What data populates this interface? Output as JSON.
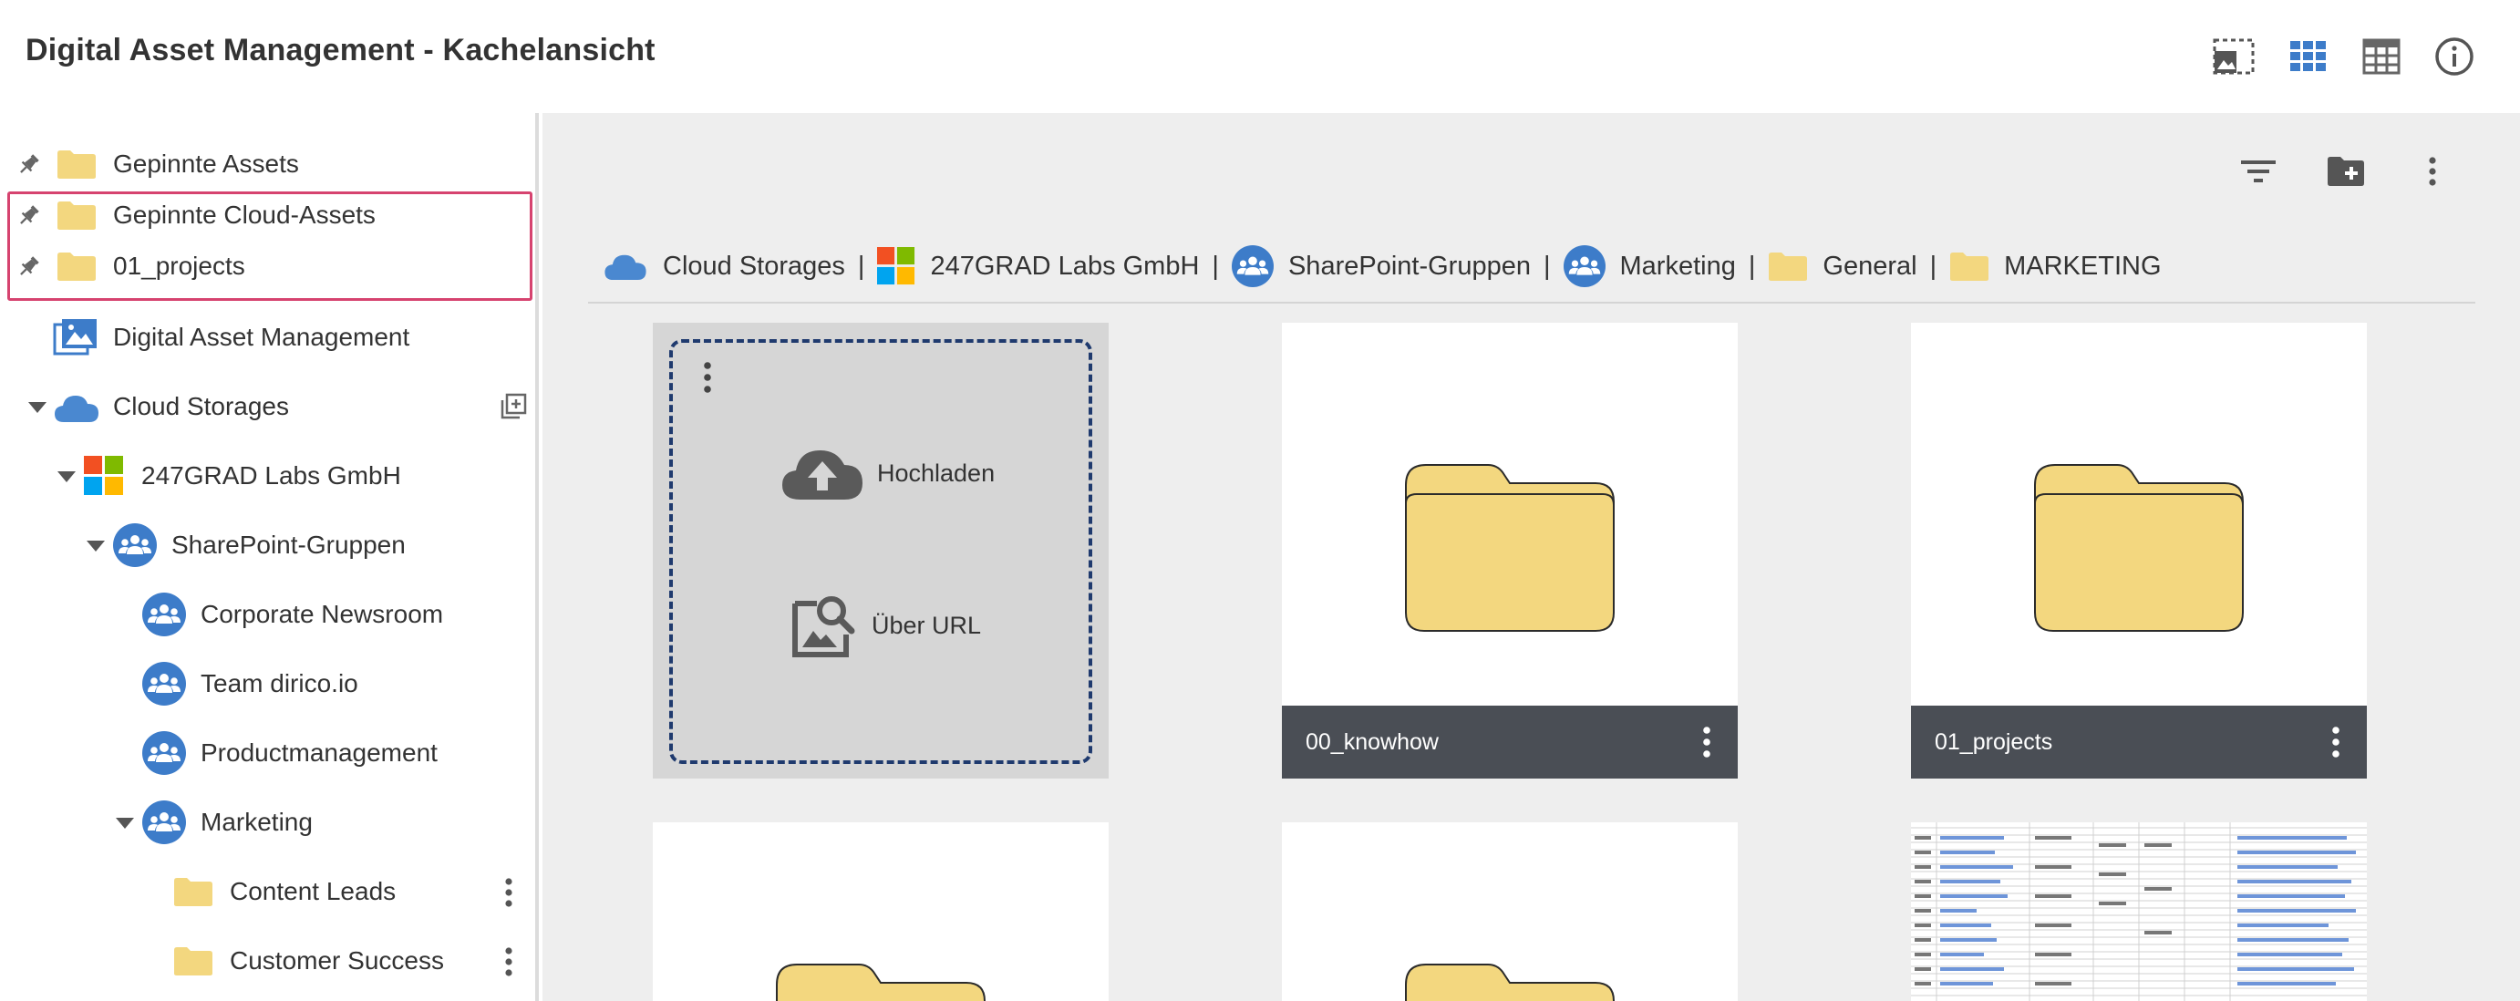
{
  "header": {
    "title": "Digital Asset Management - Kachelansicht",
    "icons": [
      "image-select-icon",
      "tile-view-icon",
      "table-view-icon",
      "info-icon"
    ],
    "accent": "#3d7cc9"
  },
  "sidebar": {
    "pinned": [
      {
        "label": "Gepinnte Assets"
      },
      {
        "label": "Gepinnte Cloud-Assets"
      },
      {
        "label": "01_projects"
      }
    ],
    "tree": {
      "dam_label": "Digital Asset Management",
      "cloud_label": "Cloud Storages",
      "company_label": "247GRAD Labs GmbH",
      "groups_label": "SharePoint-Gruppen",
      "groups": [
        {
          "label": "Corporate Newsroom"
        },
        {
          "label": "Team dirico.io"
        },
        {
          "label": "Productmanagement"
        },
        {
          "label": "Marketing"
        }
      ],
      "marketing_children": [
        {
          "label": "Content Leads"
        },
        {
          "label": "Customer Success"
        }
      ]
    },
    "highlight_color": "#d6436f"
  },
  "toolbar": {
    "icons": [
      "filter-icon",
      "new-folder-icon",
      "more-vert-icon"
    ]
  },
  "breadcrumb": {
    "items": [
      {
        "label": "Cloud Storages",
        "icon": "cloud-icon"
      },
      {
        "label": "247GRAD Labs GmbH",
        "icon": "microsoft-logo-icon"
      },
      {
        "label": "SharePoint-Gruppen",
        "icon": "group-icon"
      },
      {
        "label": "Marketing",
        "icon": "group-icon"
      },
      {
        "label": "General",
        "icon": "folder-icon"
      },
      {
        "label": "MARKETING",
        "icon": "folder-icon"
      }
    ],
    "separator": "|"
  },
  "upload": {
    "upload_label": "Hochladen",
    "url_label": "Über URL"
  },
  "tiles": [
    {
      "name": "00_knowhow"
    },
    {
      "name": "01_projects"
    }
  ],
  "colors": {
    "folder_fill": "#f3d77f",
    "folder_dark": "#e8c35a",
    "tile_footer": "#4a4e55",
    "group_blue": "#3d7cc9",
    "cloud_blue": "#4a88d0"
  }
}
